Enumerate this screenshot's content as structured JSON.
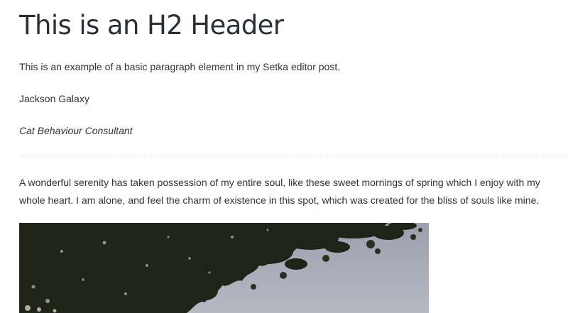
{
  "post": {
    "heading": "This is an H2 Header",
    "paragraph_basic": "This is an example of a basic paragraph element in my Setka editor post.",
    "author_name": "Jackson Galaxy",
    "author_role": "Cat Behaviour Consultant",
    "body_text": "A wonderful serenity has taken possession of my entire soul, like these sweet mornings of spring which I enjoy with my whole heart. I am alone, and feel the charm of existence in this spot, which was created for the bliss of souls like mine."
  }
}
